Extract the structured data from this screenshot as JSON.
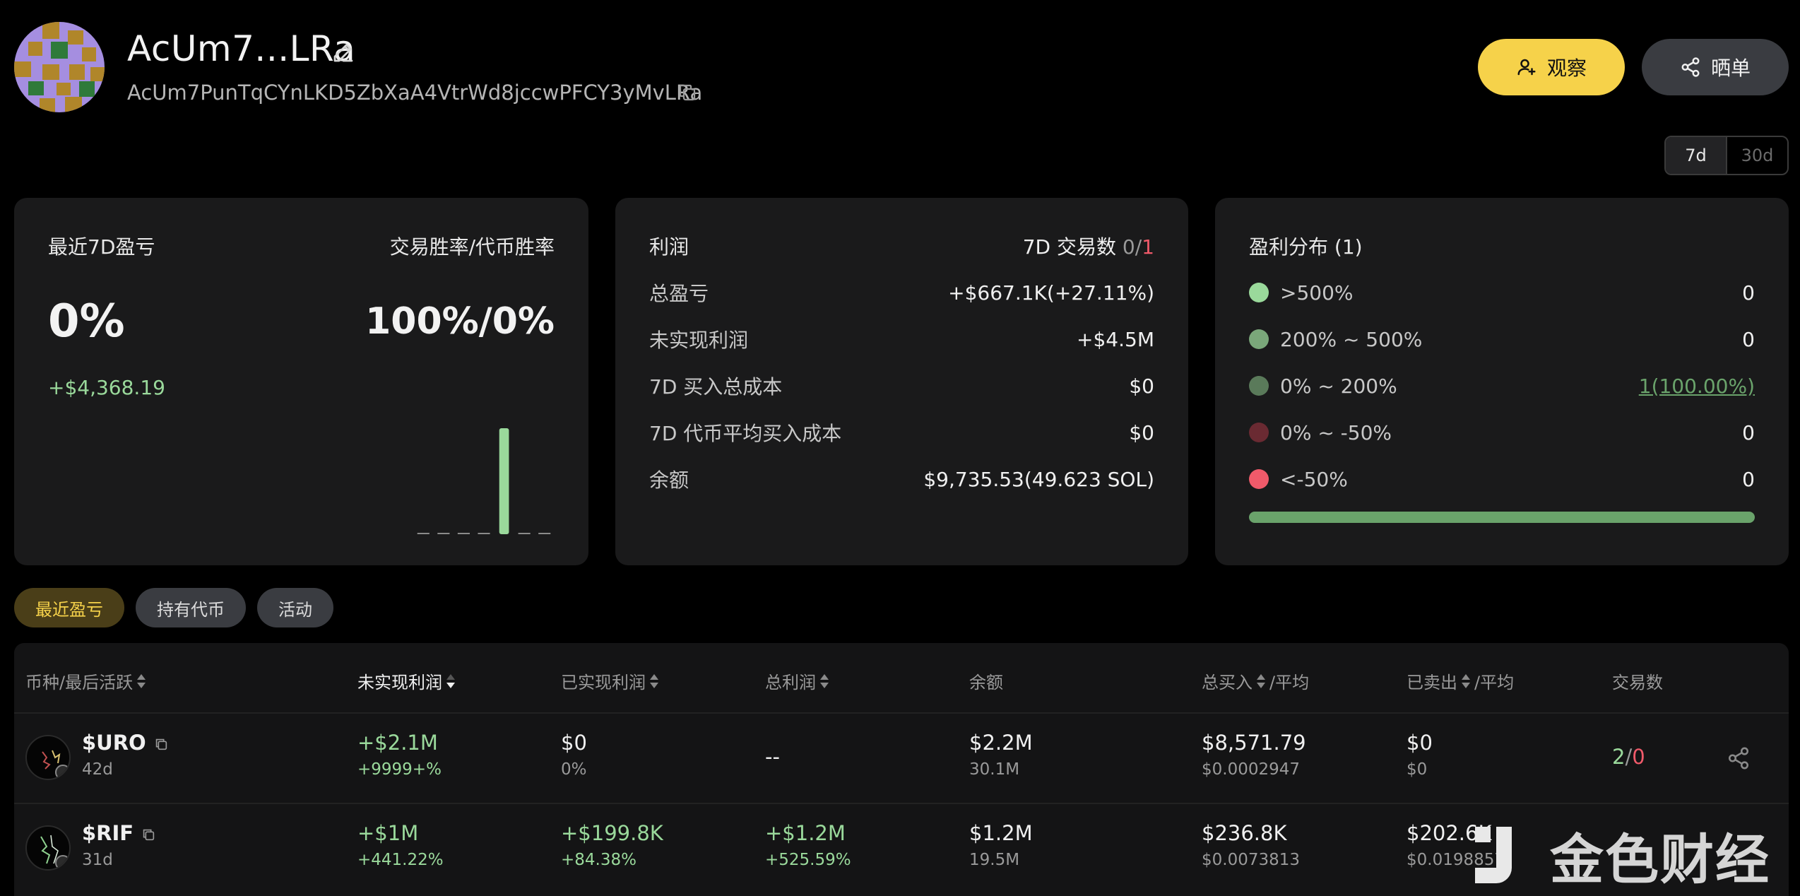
{
  "profile": {
    "name": "AcUm7...LRa",
    "address": "AcUm7PunTqCYnLKD5ZbXaA4VtrWd8jccwPFCY3yMvLRa"
  },
  "actions": {
    "watch_label": "观察",
    "share_label": "晒单"
  },
  "period": {
    "options": [
      "7d",
      "30d"
    ],
    "selected": "7d"
  },
  "summary": {
    "title": "最近7D盈亏",
    "rate_title": "交易胜率/代币胜率",
    "pnl_percent": "0%",
    "win_rate": "100%/0%",
    "pnl_amount": "+$4,368.19",
    "mini_bars": [
      0,
      0,
      0,
      0,
      1,
      0,
      0
    ]
  },
  "profit": {
    "title": "利润",
    "trades_label": "7D 交易数",
    "trades_win": "0",
    "trades_sep": "/",
    "trades_loss": "1",
    "rows": [
      {
        "label": "总盈亏",
        "value": "+$667.1K(+27.11%)",
        "tone": "green"
      },
      {
        "label": "未实现利润",
        "value": "+$4.5M",
        "tone": "green"
      },
      {
        "label": "7D 买入总成本",
        "value": "$0",
        "tone": ""
      },
      {
        "label": "7D 代币平均买入成本",
        "value": "$0",
        "tone": ""
      },
      {
        "label": "余额",
        "value": "$9,735.53(49.623 SOL)",
        "tone": ""
      }
    ]
  },
  "distribution": {
    "title": "盈利分布 (1)",
    "rows": [
      {
        "label": ">500%",
        "value": "0",
        "color": "#9ad99b",
        "link": false
      },
      {
        "label": "200% ~ 500%",
        "value": "0",
        "color": "#7aa77a",
        "link": false
      },
      {
        "label": "0% ~ 200%",
        "value": "1(100.00%)",
        "color": "#5a7a5a",
        "link": true
      },
      {
        "label": "0% ~ -50%",
        "value": "0",
        "color": "#6a2a32",
        "link": false
      },
      {
        "label": "<-50%",
        "value": "0",
        "color": "#f05a6a",
        "link": false
      }
    ],
    "bar_fraction": 1.0,
    "bar_color": "#6aa36b"
  },
  "tabs": [
    "最近盈亏",
    "持有代币",
    "活动"
  ],
  "table": {
    "headers": {
      "token": "币种/最后活跃",
      "unrealized": "未实现利润",
      "realized": "已实现利润",
      "total": "总利润",
      "balance": "余额",
      "bought": "总买入",
      "bought_avg": "/平均",
      "sold": "已卖出",
      "sold_avg": "/平均",
      "trades": "交易数"
    },
    "rows": [
      {
        "token": "$URO",
        "active": "42d",
        "unrealized": "+$2.1M",
        "unrealized_pct": "+9999+%",
        "realized": "$0",
        "realized_pct": "0%",
        "total": "--",
        "total_pct": "",
        "balance": "$2.2M",
        "balance_qty": "30.1M",
        "bought": "$8,571.79",
        "bought_avg": "$0.0002947",
        "sold": "$0",
        "sold_avg": "$0",
        "trades_buy": "2",
        "trades_sep": "/",
        "trades_sell": "0"
      },
      {
        "token": "$RIF",
        "active": "31d",
        "unrealized": "+$1M",
        "unrealized_pct": "+441.22%",
        "realized": "+$199.8K",
        "realized_pct": "+84.38%",
        "total": "+$1.2M",
        "total_pct": "+525.59%",
        "balance": "$1.2M",
        "balance_qty": "19.5M",
        "bought": "$236.8K",
        "bought_avg": "$0.0073813",
        "sold": "$202.6K",
        "sold_avg": "$0.0198857"
      }
    ]
  },
  "watermark": {
    "text": "金色财经"
  }
}
